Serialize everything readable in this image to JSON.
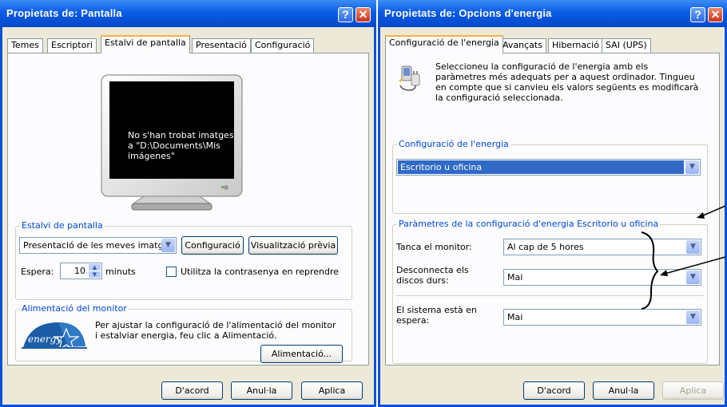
{
  "window1": {
    "title": "Propietats de: Pantalla",
    "tabs": [
      "Temes",
      "Escriptori",
      "Estalvi de pantalla",
      "Presentació",
      "Configuració"
    ],
    "active_tab": "Estalvi de pantalla",
    "preview_message": "No s'han trobat imatges a \"D:\\Documents\\Mis imágenes\"",
    "screensaver_group": {
      "legend": "Estalvi de pantalla",
      "selected": "Presentació de les meves imatg",
      "config_button": "Configuració",
      "preview_button": "Visualització prèvia",
      "wait_label": "Espera:",
      "wait_value": "10",
      "minutes_label": "minuts",
      "password_checkbox_label": "Utilitza la contrasenya en reprendre",
      "password_checked": false
    },
    "power_group": {
      "legend": "Alimentació del monitor",
      "text": "Per ajustar la configuració de l'alimentació del monitor i estalviar energia, feu clic a Alimentació.",
      "button": "Alimentació...",
      "logo_text": "energy"
    },
    "buttons": {
      "ok": "D'acord",
      "cancel": "Anul·la",
      "apply": "Aplica"
    }
  },
  "window2": {
    "title": "Propietats de: Opcions d'energia",
    "tabs": [
      "Configuració de l'energia",
      "Avançats",
      "Hibernació",
      "SAI (UPS)"
    ],
    "active_tab": "Configuració de l'energia",
    "intro": "Seleccioneu la configuració de l'energia amb els paràmetres més adequats per a aquest ordinador. Tingueu en compte que si canvieu els valors següents es modificarà la configuració seleccionada.",
    "scheme_group": {
      "legend": "Configuració de l'energia",
      "selected": "Escritorio u oficina"
    },
    "settings_group": {
      "legend": "Paràmetres de la configuració d'energia Escritorio u oficina",
      "monitor_label": "Tanca el monitor:",
      "monitor_value": "Al cap de 5 hores",
      "disks_label": "Desconnecta els discos durs:",
      "disks_value": "Mai",
      "standby_label": "El sistema està en espera:",
      "standby_value": "Mai"
    },
    "buttons": {
      "ok": "D'acord",
      "cancel": "Anul·la",
      "apply": "Aplica"
    }
  },
  "colors": {
    "title_bar": "#0a5ce6",
    "group_legend": "#0046d5",
    "face": "#ece9d8",
    "active_tab_top": "#f6b33c"
  }
}
